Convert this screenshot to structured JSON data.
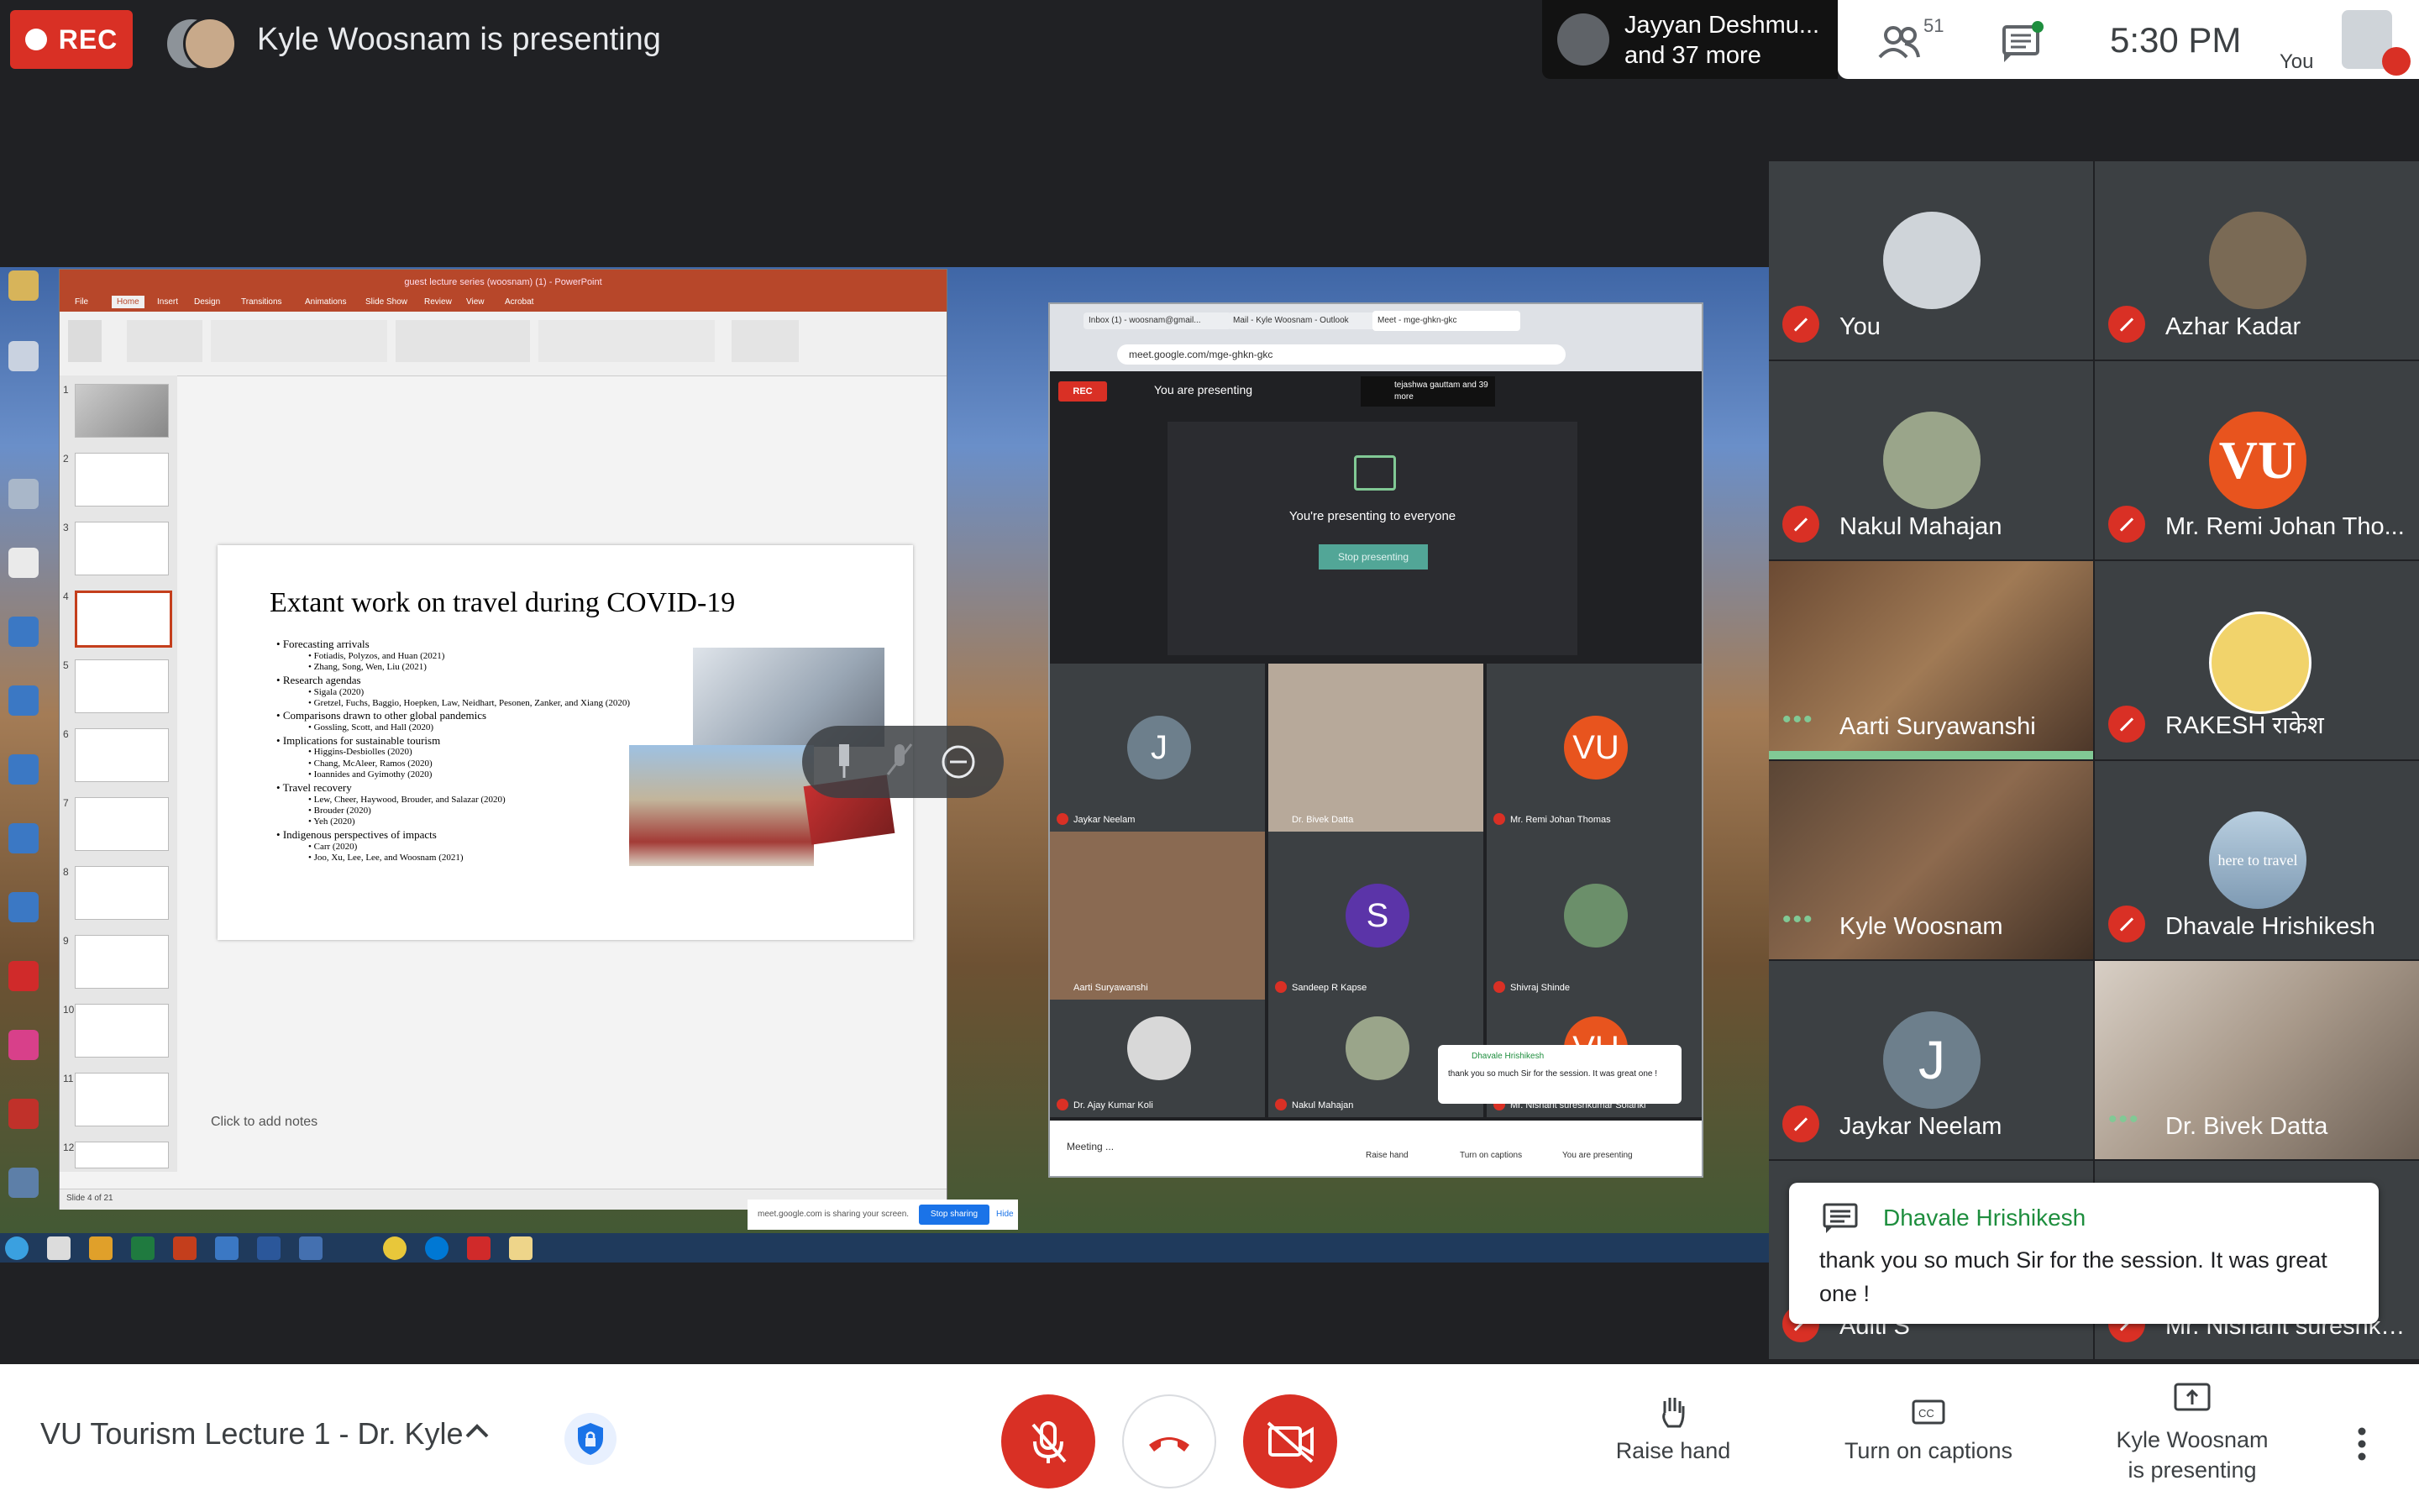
{
  "top_bar": {
    "rec_label": "REC",
    "presenting_text": "Kyle Woosnam is presenting",
    "participants_chip_line1": "Jayyan Deshmu...",
    "participants_chip_line2": "and 37 more",
    "people_count": "51",
    "clock": "5:30 PM",
    "self_label": "You"
  },
  "shared_screen": {
    "ppt": {
      "window_title": "guest lecture series (woosnam) (1) - PowerPoint",
      "tabs": [
        "File",
        "Home",
        "Insert",
        "Design",
        "Transitions",
        "Animations",
        "Slide Show",
        "Review",
        "View",
        "Acrobat"
      ],
      "slide_title": "Extant work on travel during COVID-19",
      "bullets": [
        {
          "level": 1,
          "text": "Forecasting arrivals"
        },
        {
          "level": 2,
          "text": "Fotiadis, Polyzos, and Huan (2021)"
        },
        {
          "level": 2,
          "text": "Zhang, Song, Wen, Liu (2021)"
        },
        {
          "level": 1,
          "text": "Research agendas"
        },
        {
          "level": 2,
          "text": "Sigala (2020)"
        },
        {
          "level": 2,
          "text": "Gretzel, Fuchs, Baggio, Hoepken, Law, Neidhart, Pesonen, Zanker, and Xiang (2020)"
        },
        {
          "level": 1,
          "text": "Comparisons drawn to other global pandemics"
        },
        {
          "level": 2,
          "text": "Gossling, Scott, and Hall (2020)"
        },
        {
          "level": 1,
          "text": "Implications for sustainable tourism"
        },
        {
          "level": 2,
          "text": "Higgins-Desbiolles (2020)"
        },
        {
          "level": 2,
          "text": "Chang, McAleer, Ramos (2020)"
        },
        {
          "level": 2,
          "text": "Ioannides and Gyimothy (2020)"
        },
        {
          "level": 1,
          "text": "Travel recovery"
        },
        {
          "level": 2,
          "text": "Lew, Cheer, Haywood, Brouder, and Salazar (2020)"
        },
        {
          "level": 2,
          "text": "Brouder (2020)"
        },
        {
          "level": 2,
          "text": "Yeh (2020)"
        },
        {
          "level": 1,
          "text": "Indigenous perspectives of impacts"
        },
        {
          "level": 2,
          "text": "Carr (2020)"
        },
        {
          "level": 2,
          "text": "Joo, Xu, Lee, Lee, and Woosnam (2021)"
        }
      ],
      "thumb_numbers": [
        "1",
        "2",
        "3",
        "4",
        "5",
        "6",
        "7",
        "8",
        "9",
        "10",
        "11",
        "12"
      ],
      "selected_thumb": 4,
      "notes_placeholder": "Click to add notes",
      "status_slide": "Slide 4 of 21"
    },
    "inner_meet": {
      "url": "meet.google.com/mge-ghkn-gkc",
      "tabs": [
        "Inbox (1) - woosnam@gmail...",
        "Mail - Kyle Woosnam - Outlook",
        "Meet - mge-ghkn-gkc"
      ],
      "rec_label": "REC",
      "presenting_text": "You are presenting",
      "people_chip": "tejashwa gauttam and 39 more",
      "present_msg": "You're presenting to everyone",
      "stop_btn": "Stop presenting",
      "tiles": [
        {
          "name": "Jaykar Neelam",
          "initial": "J",
          "color": "#6d7f8c"
        },
        {
          "name": "Dr. Bivek Datta",
          "initial": "",
          "color": "#b7a99a"
        },
        {
          "name": "Mr. Remi Johan Thomas",
          "initial": "VU",
          "color": "#e8541e"
        },
        {
          "name": "Aarti Suryawanshi",
          "initial": "",
          "color": "#8a6a52"
        },
        {
          "name": "Sandeep R Kapse",
          "initial": "S",
          "color": "#5b34a8"
        },
        {
          "name": "Shivraj Shinde",
          "initial": "",
          "color": "#6b8f6a"
        },
        {
          "name": "Dr. Ajay Kumar Koli",
          "initial": "",
          "color": "#d8d8d8"
        },
        {
          "name": "Nakul Mahajan",
          "initial": "",
          "color": "#9aa58a"
        },
        {
          "name": "Mr. Nishant sureshkumar Solanki",
          "initial": "VU",
          "color": "#e8541e"
        }
      ],
      "chat_sender": "Dhavale Hrishikesh",
      "chat_text": "thank you so much Sir for the session. It was great one !",
      "bottom_meeting": "Meeting ...",
      "bottom_raise": "Raise hand",
      "bottom_captions": "Turn on captions",
      "bottom_presenting": "You are presenting",
      "sharing_text": "meet.google.com is sharing your screen.",
      "sharing_stop": "Stop sharing",
      "sharing_hide": "Hide"
    }
  },
  "participants": [
    {
      "name": "You",
      "type": "avatar",
      "color": "#cfd4d9",
      "initial": ""
    },
    {
      "name": "Azhar Kadar",
      "type": "avatar",
      "color": "#7a6a55",
      "initial": ""
    },
    {
      "name": "Nakul Mahajan",
      "type": "avatar",
      "color": "#9aa58a",
      "initial": ""
    },
    {
      "name": "Mr. Remi Johan Tho...",
      "type": "avatar",
      "color": "#e8541e",
      "initial": "VU"
    },
    {
      "name": "Aarti Suryawanshi",
      "type": "video",
      "color": "#8a6a52",
      "initial": ""
    },
    {
      "name": "RAKESH राकेश",
      "type": "avatar",
      "color": "#f1d36b",
      "initial": ""
    },
    {
      "name": "Kyle Woosnam",
      "type": "video",
      "color": "#7b5a40",
      "initial": ""
    },
    {
      "name": "Dhavale Hrishikesh",
      "type": "avatar",
      "color": "#8fb0c9",
      "initial": "here to travel"
    },
    {
      "name": "Jaykar Neelam",
      "type": "avatar",
      "color": "#6d7f8c",
      "initial": "J"
    },
    {
      "name": "Dr. Bivek Datta",
      "type": "video",
      "color": "#b7a99a",
      "initial": ""
    },
    {
      "name": "Aditi S",
      "type": "avatar",
      "color": "#5f6368",
      "initial": ""
    },
    {
      "name": "Mr. Nishant sureshku...",
      "type": "avatar",
      "color": "#5f6368",
      "initial": ""
    }
  ],
  "chat_popup": {
    "sender": "Dhavale Hrishikesh",
    "message": "thank you so much Sir for the session. It was great one  !"
  },
  "bottom_bar": {
    "meeting_title": "VU Tourism Lecture 1 - Dr. Kyle",
    "raise_hand": "Raise hand",
    "captions": "Turn on captions",
    "presenting_line1": "Kyle Woosnam",
    "presenting_line2": "is presenting"
  },
  "colors": {
    "red": "#d93025",
    "green": "#81c995",
    "background": "#202124",
    "tile": "#3c4043"
  }
}
